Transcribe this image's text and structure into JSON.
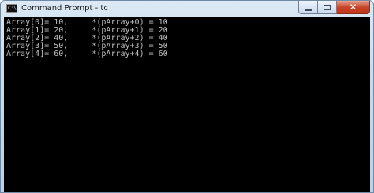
{
  "window": {
    "title": "Command Prompt - tc",
    "icon": "console-icon",
    "icon_glyph": "C:\\",
    "controls": {
      "minimize_icon": "minimize-icon",
      "maximize_icon": "maximize-icon",
      "close_icon": "close-icon",
      "close_glyph": "✕"
    },
    "colors": {
      "console_background": "#000000",
      "console_text": "#c0c0c0",
      "close_button": "#c43617"
    }
  },
  "console": {
    "lines": [
      "Array[0]= 10,     *(pArray+0) = 10",
      "Array[1]= 20,     *(pArray+1) = 20",
      "Array[2]= 40,     *(pArray+2) = 40",
      "Array[3]= 50,     *(pArray+3) = 50",
      "Array[4]= 60,     *(pArray+4) = 60"
    ]
  }
}
